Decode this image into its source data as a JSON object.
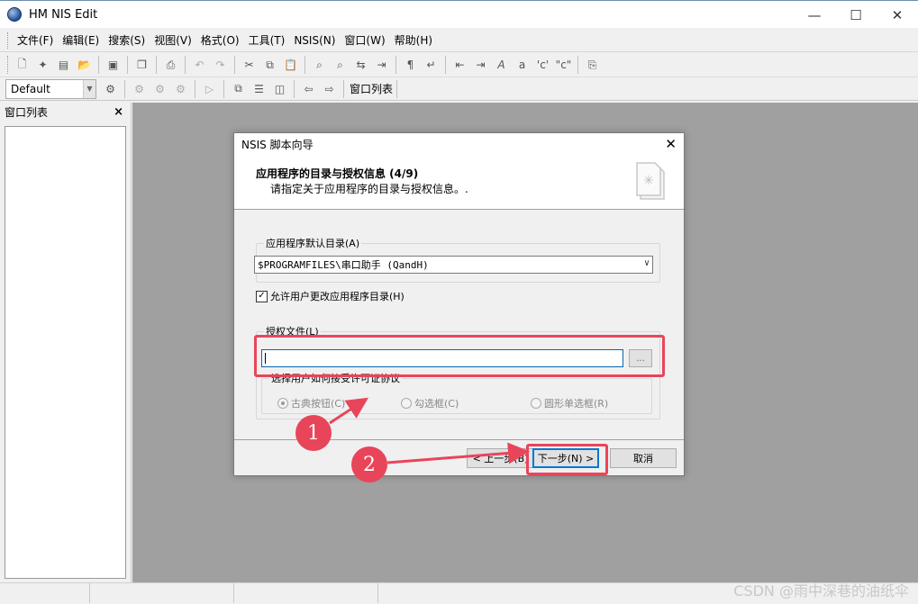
{
  "window": {
    "title": "HM NIS Edit",
    "minimize_glyph": "—",
    "maximize_glyph": "☐",
    "close_glyph": "✕"
  },
  "menu": [
    "文件(F)",
    "编辑(E)",
    "搜索(S)",
    "视图(V)",
    "格式(O)",
    "工具(T)",
    "NSIS(N)",
    "窗口(W)",
    "帮助(H)"
  ],
  "toolbar1_icons": [
    "new-file-icon",
    "wizard-icon",
    "template-icon",
    "open-folder-icon",
    "save-icon",
    "save-all-icon",
    "print-icon",
    "undo-icon",
    "redo-icon",
    "cut-icon",
    "copy-icon",
    "paste-icon",
    "find-icon",
    "find-next-icon",
    "replace-icon",
    "goto-icon",
    "paragraph-icon",
    "wrap-icon",
    "indent-icon",
    "outdent-icon",
    "uppercase-icon",
    "lowercase-icon",
    "single-quote-icon",
    "double-quote-icon",
    "insert-file-icon"
  ],
  "toolbar2": {
    "scheme_value": "Default",
    "window_list_label": "窗口列表"
  },
  "left_panel": {
    "title": "窗口列表",
    "close_glyph": "×"
  },
  "dialog": {
    "title": "NSIS 脚本向导",
    "heading": "应用程序的目录与授权信息 (4/9)",
    "subheading": "请指定关于应用程序的目录与授权信息。.",
    "dir_group_label": "应用程序默认目录(A)",
    "dir_value": "$PROGRAMFILES\\串口助手 (QandH)",
    "allow_change_label": "允许用户更改应用程序目录(H)",
    "allow_change_checked": true,
    "license_group_label": "授权文件(L)",
    "license_value": "",
    "browse_label": "...",
    "accept_group_label": "选择用户如何接受许可证协议",
    "radios": [
      {
        "label": "古典按钮(C)",
        "selected": true
      },
      {
        "label": "勾选框(C)",
        "selected": false
      },
      {
        "label": "圆形单选框(R)",
        "selected": false
      }
    ],
    "back_label": "< 上一步(B)",
    "next_label": "下一步(N) >",
    "cancel_label": "取消"
  },
  "annotations": {
    "badge_1": "1",
    "badge_2": "2",
    "color": "#e8455a"
  },
  "watermark": "CSDN @雨中深巷的油纸伞"
}
